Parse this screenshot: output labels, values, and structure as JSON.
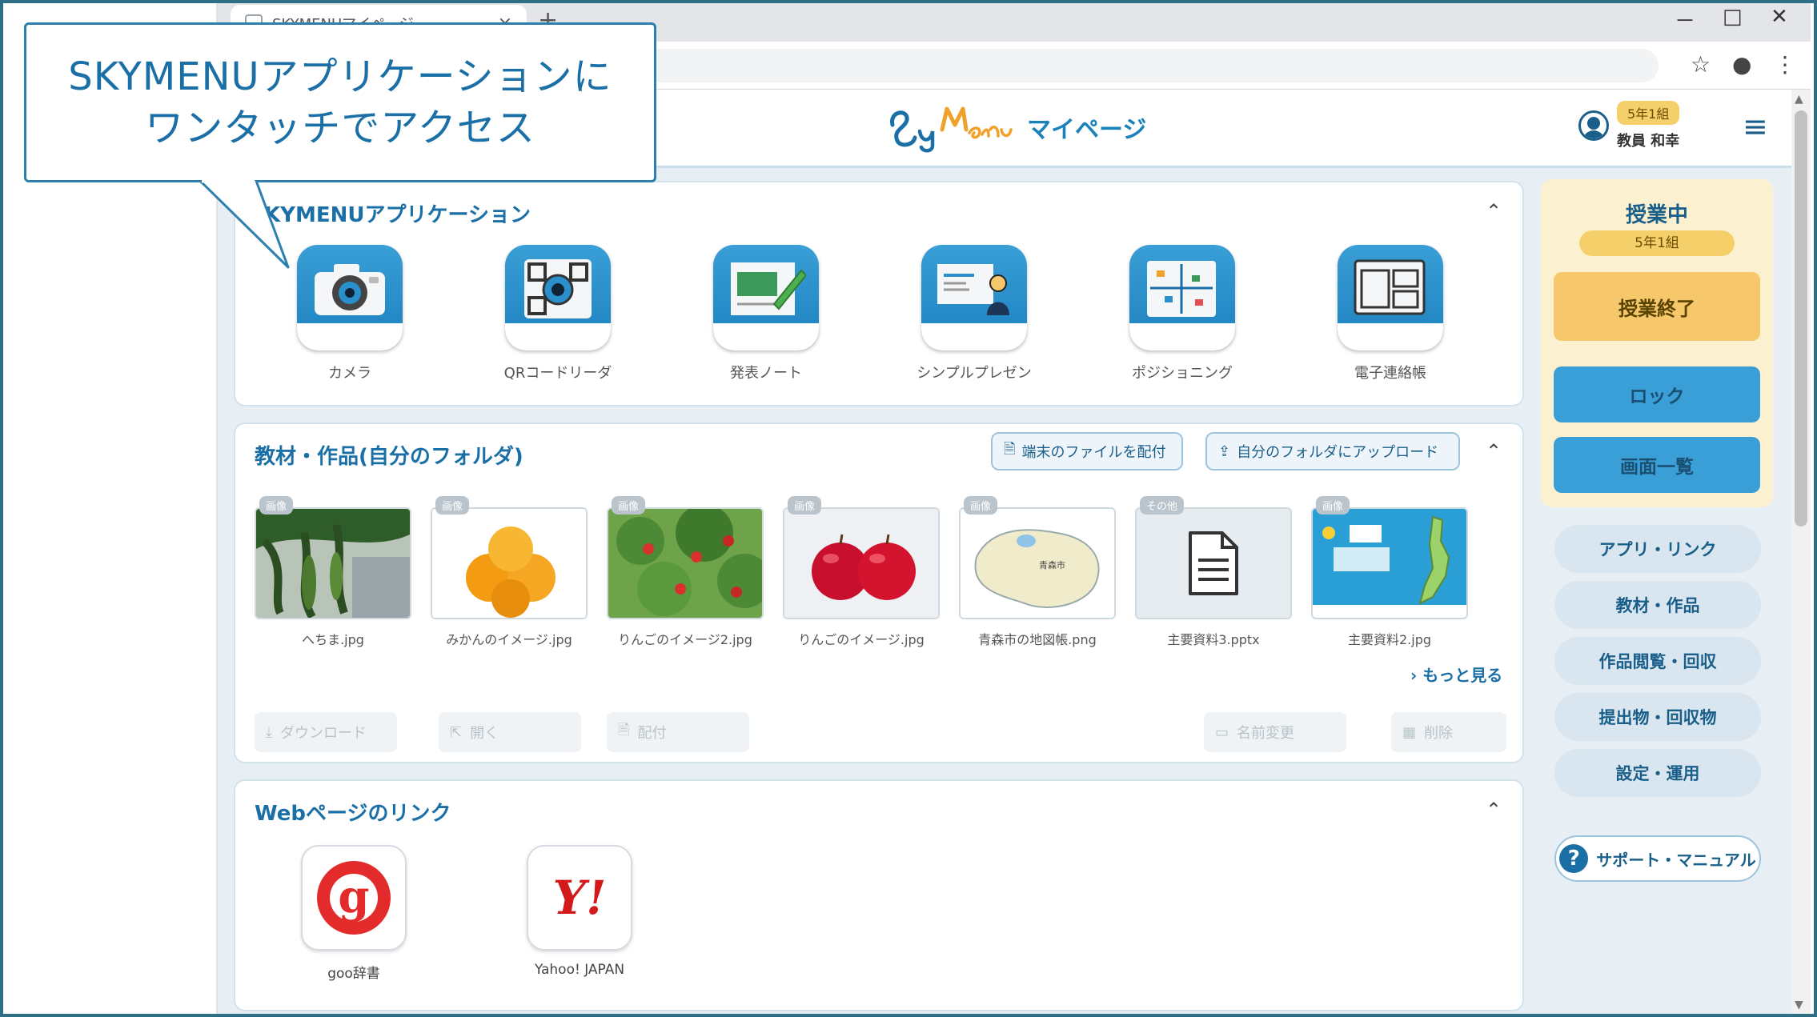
{
  "browser": {
    "tab_title": "SKYMENUマイページ",
    "tab_close": "×",
    "new_tab": "+",
    "window_controls": [
      "－",
      "□",
      "✕"
    ],
    "toolbar_icons": [
      "☆",
      "●",
      "⋮"
    ]
  },
  "header": {
    "logo_alt": "SkyMenu",
    "logo_suffix": "マイページ",
    "user_class": "5年1組",
    "user_name": "教員 和幸",
    "menu_icon": "≡"
  },
  "callout": {
    "line1": "SKYMENUアプリケーションに",
    "line2": "ワンタッチでアクセス"
  },
  "apps_section": {
    "title": "KYMENUアプリケーション",
    "collapse": "⌃",
    "apps": [
      {
        "label": "カメラ",
        "icon": "camera-icon"
      },
      {
        "label": "QRコードリーダ",
        "icon": "qr-reader-icon"
      },
      {
        "label": "発表ノート",
        "icon": "presentation-note-icon"
      },
      {
        "label": "シンプルプレゼン",
        "icon": "simple-presentation-icon"
      },
      {
        "label": "ポジショニング",
        "icon": "positioning-icon"
      },
      {
        "label": "電子連絡帳",
        "icon": "digital-notebook-icon"
      }
    ]
  },
  "materials_section": {
    "title": "教材・作品(自分のフォルダ)",
    "distribute_button": "端末のファイルを配付",
    "upload_button": "自分のフォルダにアップロード",
    "collapse": "⌃",
    "files": [
      {
        "tag": "画像",
        "name": "へちま.jpg"
      },
      {
        "tag": "画像",
        "name": "みかんのイメージ.jpg"
      },
      {
        "tag": "画像",
        "name": "りんごのイメージ2.jpg"
      },
      {
        "tag": "画像",
        "name": "りんごのイメージ.jpg"
      },
      {
        "tag": "画像",
        "name": "青森市の地図帳.png"
      },
      {
        "tag": "その他",
        "name": "主要資料3.pptx"
      },
      {
        "tag": "画像",
        "name": "主要資料2.jpg"
      }
    ],
    "more_link": "› もっと見る",
    "actions": {
      "download": "ダウンロード",
      "open": "開く",
      "distribute": "配付",
      "rename": "名前変更",
      "delete": "削除"
    },
    "map_label": "青森市"
  },
  "web_section": {
    "title": "Webページのリンク",
    "collapse": "⌃",
    "links": [
      {
        "label": "goo辞書",
        "glyph": "g"
      },
      {
        "label": "Yahoo! JAPAN",
        "glyph": "Y!"
      }
    ]
  },
  "sidebar": {
    "lesson_status": "授業中",
    "lesson_class": "5年1組",
    "end_lesson": "授業終了",
    "lock": "ロック",
    "screen_list": "画面一覧",
    "menu": [
      "アプリ・リンク",
      "教材・作品",
      "作品閲覧・回収",
      "提出物・回収物",
      "設定・運用"
    ],
    "support": "サポート・マニュアル",
    "support_icon": "?"
  },
  "colors": {
    "accent": "#1a6fa6",
    "app_icon_blue": "#2a90cc",
    "lesson_panel": "#fbf1d0",
    "end_button": "#f6c86b",
    "blue_button": "#3a9fd6"
  }
}
